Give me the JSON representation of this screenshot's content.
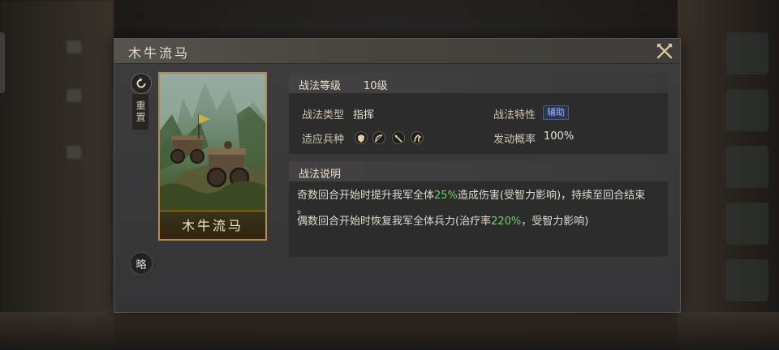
{
  "dialog": {
    "title": "木牛流马",
    "reset_label": "重置",
    "strategy_label": "略"
  },
  "card": {
    "name": "木牛流马",
    "border_color": "#b08c4e"
  },
  "level": {
    "label": "战法等级",
    "value": "10级"
  },
  "attributes": {
    "type_label": "战法类型",
    "type_value": "指挥",
    "trait_label": "战法特性",
    "trait_value": "辅助",
    "units_label": "适应兵种",
    "unit_icons": [
      "shield-icon",
      "bow-icon",
      "spear-icon",
      "horse-icon"
    ],
    "chance_label": "发动概率",
    "chance_value": "100%"
  },
  "description": {
    "label": "战法说明",
    "line1_pre": "奇数回合开始时提升我军全体",
    "line1_pct": "25%",
    "line1_post": "造成伤害(受智力影响)，持续至回合结束",
    "line2": "。",
    "line3_pre": "偶数回合开始时恢复我军全体兵力(治疗率",
    "line3_pct": "220%",
    "line3_post": "，受智力影响)"
  },
  "colors": {
    "highlight_green": "#6fcf6b",
    "tag_blue": "#8fb6ff"
  }
}
